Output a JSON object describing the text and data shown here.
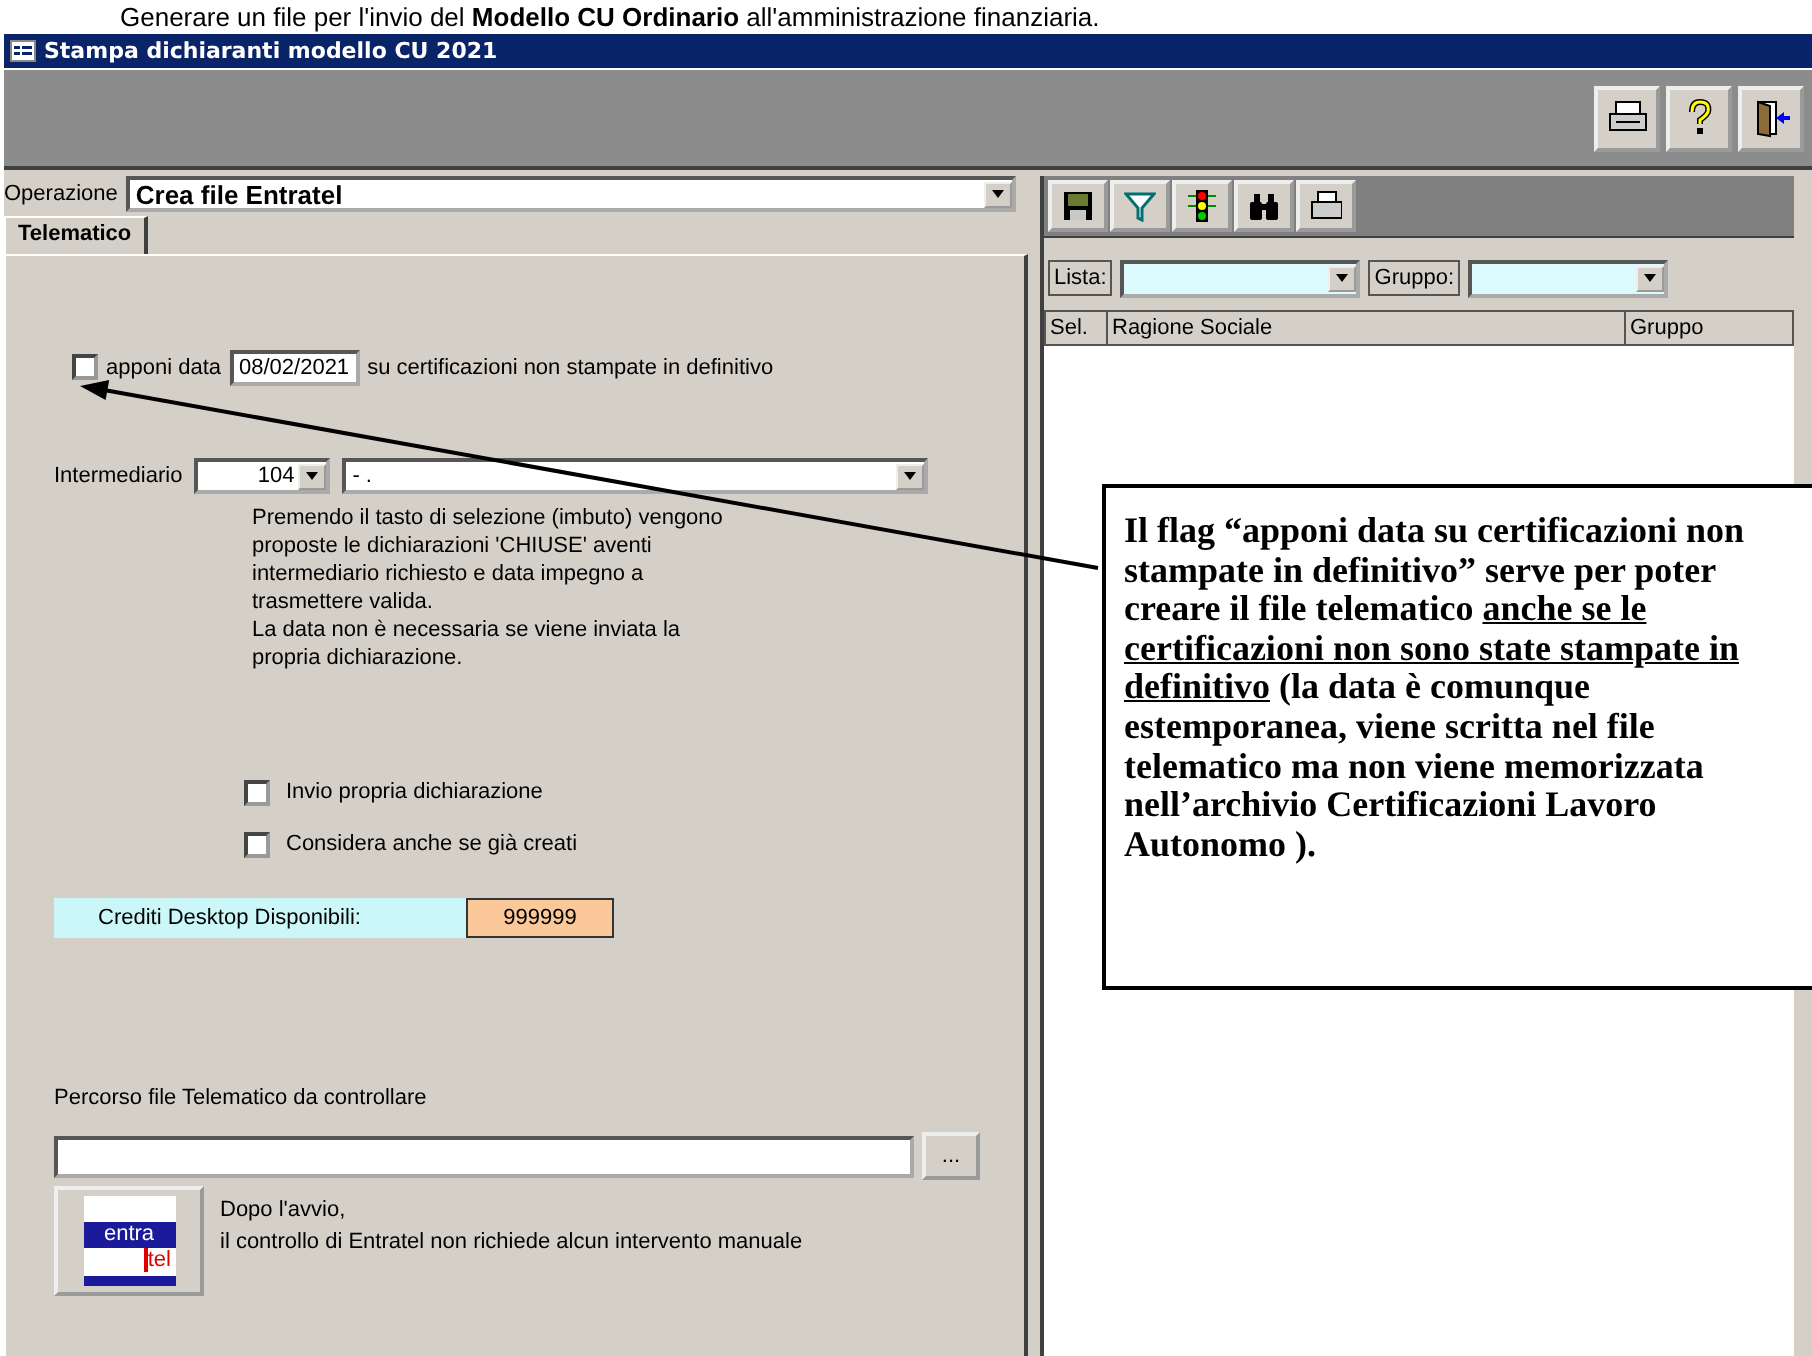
{
  "document_line": "Generare un file per l'invio del **Modello CU Ordinario** all'amministrazione finanziaria.",
  "window": {
    "title": "Stampa dichiaranti modello CU  2021"
  },
  "operation": {
    "label": "Operazione",
    "value": "Crea file Entratel"
  },
  "tabs": [
    {
      "label": "Telematico",
      "selected": true
    }
  ],
  "date_option": {
    "checked": false,
    "label": "apponi data",
    "date": "08/02/2021",
    "suffix": "su certificazioni non stampate in definitivo"
  },
  "intermediary": {
    "label": "Intermediario",
    "code": "104",
    "name": "- ."
  },
  "description": "Premendo il tasto di selezione (imbuto) vengono\nproposte le dichiarazioni 'CHIUSE' aventi\nintermediario richiesto e data impegno a\ntrasmettere valida.\nLa data non è necessaria se viene inviata la\npropria dichiarazione.",
  "options": [
    {
      "label": "Invio propria dichiarazione",
      "checked": false
    },
    {
      "label": "Considera anche se già creati",
      "checked": false
    }
  ],
  "credits": {
    "label": "Crediti Desktop Disponibili:",
    "value": "999999"
  },
  "path": {
    "label": "Percorso file Telematico da controllare",
    "browse": "..."
  },
  "entratel": {
    "logo_top": "entra",
    "logo_bottom": "tel",
    "note": "Dopo l'avvio,\nil controllo di Entratel non richiede alcun intervento manuale"
  },
  "list_panel": {
    "lista_label": "Lista:",
    "gruppo_label": "Gruppo:",
    "columns": [
      "Sel.",
      "Ragione Sociale",
      "Gruppo"
    ]
  },
  "callout": {
    "segments": [
      {
        "text": "Il flag “apponi data su certificazioni non stampate in definitivo” serve per poter creare il file telematico ",
        "underline": false
      },
      {
        "text": "anche se le certificazioni non sono state stampate in definitivo",
        "underline": true
      },
      {
        "text": " (la data è comunque estemporanea, viene scritta nel file telematico ma non viene memorizzata nell’archivio Certificazioni Lavoro Autonomo ).",
        "underline": false
      }
    ]
  }
}
